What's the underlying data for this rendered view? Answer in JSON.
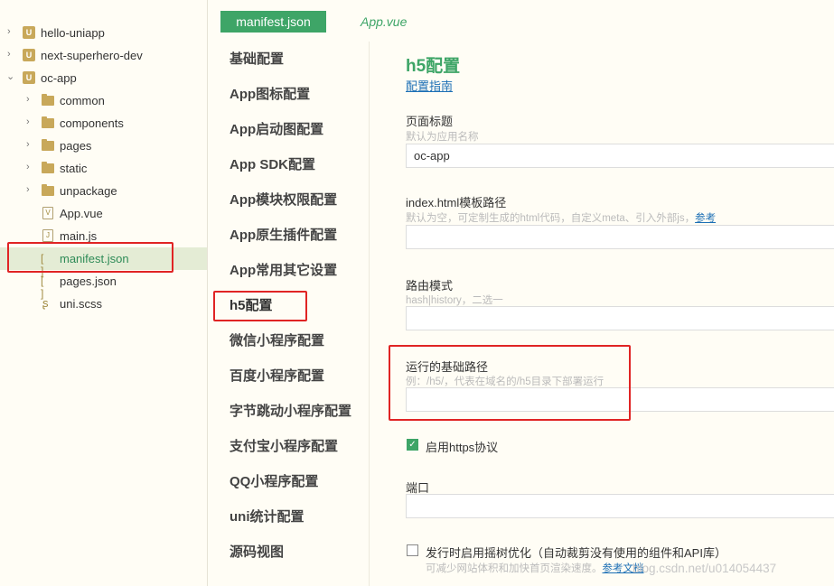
{
  "tree": {
    "items": [
      {
        "label": "hello-uniapp",
        "icon": "project-icon",
        "chevron": "chevron-right-icon"
      },
      {
        "label": "next-superhero-dev",
        "icon": "project-icon",
        "chevron": "chevron-right-icon"
      },
      {
        "label": "oc-app",
        "icon": "project-icon",
        "chevron": "chevron-down-icon"
      },
      {
        "label": "common",
        "icon": "folder-icon",
        "chevron": "chevron-right-icon"
      },
      {
        "label": "components",
        "icon": "folder-icon",
        "chevron": "chevron-right-icon"
      },
      {
        "label": "pages",
        "icon": "folder-icon",
        "chevron": "chevron-right-icon"
      },
      {
        "label": "static",
        "icon": "folder-icon",
        "chevron": "chevron-right-icon"
      },
      {
        "label": "unpackage",
        "icon": "folder-icon",
        "chevron": "chevron-right-icon"
      },
      {
        "label": "App.vue",
        "icon": "vue-file-icon"
      },
      {
        "label": "main.js",
        "icon": "js-file-icon"
      },
      {
        "label": "manifest.json",
        "icon": "json-file-icon"
      },
      {
        "label": "pages.json",
        "icon": "json-file-icon"
      },
      {
        "label": "uni.scss",
        "icon": "scss-file-icon"
      }
    ],
    "icon_glyphs": {
      "project": "U",
      "vue": "V",
      "js": "J",
      "json": "[ ]",
      "scss": "ʂ"
    }
  },
  "tabs": {
    "manifest": "manifest.json",
    "app": "App.vue"
  },
  "nav": [
    "基础配置",
    "App图标配置",
    "App启动图配置",
    "App SDK配置",
    "App模块权限配置",
    "App原生插件配置",
    "App常用其它设置",
    "h5配置",
    "微信小程序配置",
    "百度小程序配置",
    "字节跳动小程序配置",
    "支付宝小程序配置",
    "QQ小程序配置",
    "uni统计配置",
    "源码视图"
  ],
  "form": {
    "title": "h5配置",
    "guide_link": "配置指南",
    "page_title": {
      "label": "页面标题",
      "hint": "默认为应用名称",
      "value": "oc-app"
    },
    "template": {
      "label": "index.html模板路径",
      "hint": "默认为空，可定制生成的html代码，自定义meta、引入外部js，",
      "hint_link": "参考",
      "value": ""
    },
    "router": {
      "label": "路由模式",
      "hint": "hash|history，二选一",
      "value": ""
    },
    "base_path": {
      "label": "运行的基础路径",
      "hint": "例：/h5/，代表在域名的/h5目录下部署运行",
      "value": ""
    },
    "https": {
      "label": "启用https协议",
      "checked": true
    },
    "port": {
      "label": "端口",
      "value": ""
    },
    "treeshake": {
      "label": "发行时启用摇树优化（自动裁剪没有使用的组件和API库）",
      "hint": "可减少网站体积和加快首页渲染速度。",
      "hint_link": "参考文档",
      "checked": false
    }
  },
  "watermark": "blog.csdn.net/u014054437",
  "colors": {
    "accent": "#3ea567",
    "annotation": "#e02424",
    "link": "#1c6fb5"
  }
}
